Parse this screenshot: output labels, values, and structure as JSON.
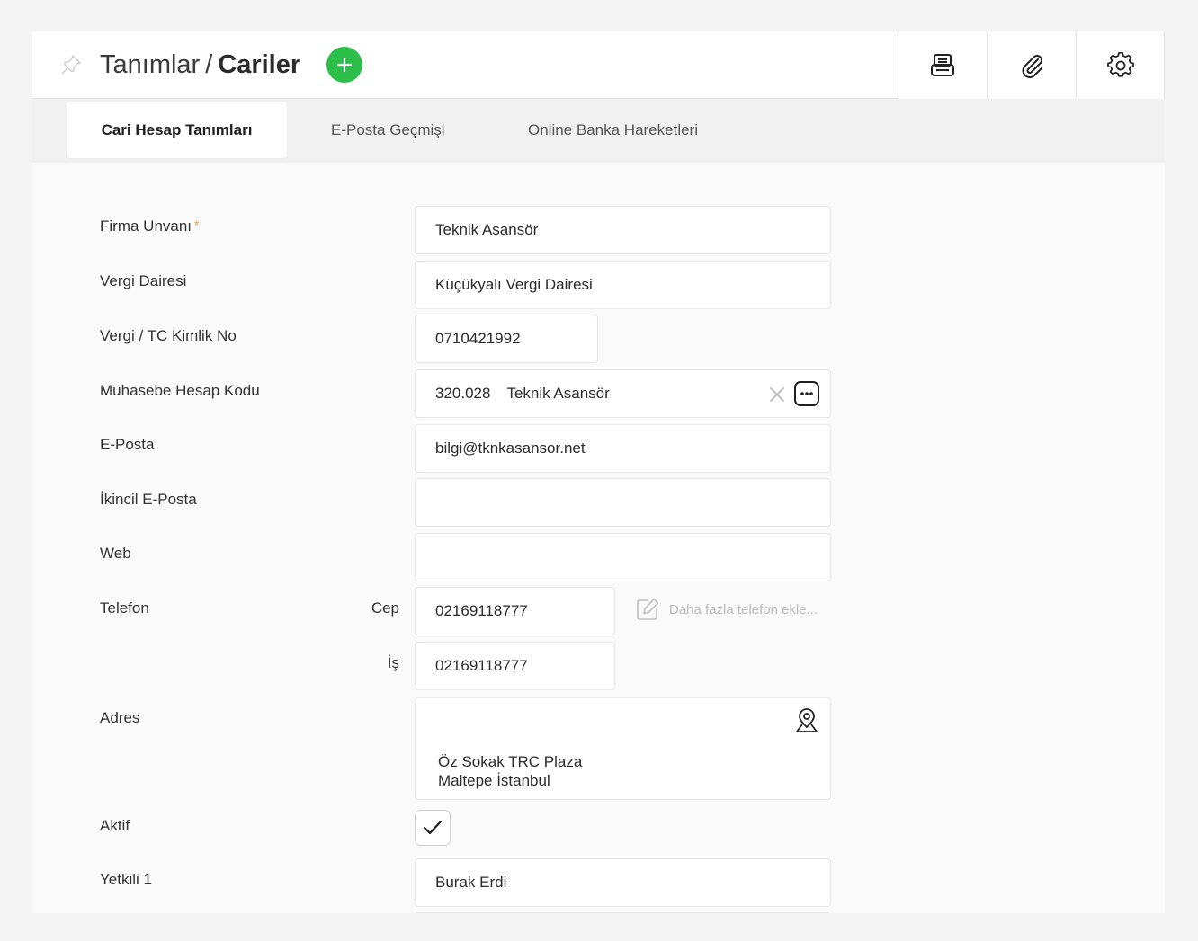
{
  "header": {
    "breadcrumb_parent": "Tanımlar",
    "breadcrumb_sep": "/",
    "breadcrumb_current": "Cariler",
    "icons": {
      "pin": "pin-icon",
      "add": "plus-icon",
      "print": "printer-icon",
      "attach": "paperclip-icon",
      "settings": "gear-icon"
    }
  },
  "tabs": [
    {
      "label": "Cari Hesap Tanımları",
      "active": true
    },
    {
      "label": "E-Posta Geçmişi",
      "active": false
    },
    {
      "label": "Online Banka Hareketleri",
      "active": false
    }
  ],
  "form": {
    "firma_unvani": {
      "label": "Firma Unvanı",
      "required_mark": "*",
      "value": "Teknik Asansör"
    },
    "vergi_dairesi": {
      "label": "Vergi Dairesi",
      "value": "Küçükyalı Vergi Dairesi"
    },
    "vergi_no": {
      "label": "Vergi / TC Kimlik No",
      "value": "0710421992"
    },
    "muhasebe_kodu": {
      "label": "Muhasebe Hesap Kodu",
      "code": "320.028",
      "name": "Teknik Asansör"
    },
    "eposta": {
      "label": "E-Posta",
      "value": "bilgi@tknkasansor.net"
    },
    "ikincil_eposta": {
      "label": "İkincil E-Posta",
      "value": ""
    },
    "web": {
      "label": "Web",
      "value": ""
    },
    "telefon": {
      "label": "Telefon",
      "cep_label": "Cep",
      "cep_value": "02169118777",
      "is_label": "İş",
      "is_value": "02169118777",
      "add_more": "Daha fazla telefon ekle..."
    },
    "adres": {
      "label": "Adres",
      "line1": "Öz Sokak TRC Plaza",
      "line2": "Maltepe İstanbul"
    },
    "aktif": {
      "label": "Aktif",
      "checked": true
    },
    "yetkili1": {
      "label": "Yetkili 1",
      "value": "Burak Erdi"
    }
  },
  "colors": {
    "accent_green": "#2bbf4a",
    "required_orange": "#f0a020"
  }
}
